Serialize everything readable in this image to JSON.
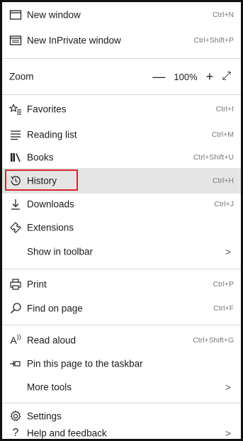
{
  "menu": {
    "new_window": {
      "label": "New window",
      "shortcut": "Ctrl+N",
      "icon": "new-window-icon"
    },
    "new_inprivate": {
      "label": "New InPrivate window",
      "shortcut": "Ctrl+Shift+P",
      "icon": "inprivate-icon"
    },
    "zoom": {
      "label": "Zoom",
      "minus": "—",
      "value": "100%",
      "plus": "+",
      "fullscreen": "⤢"
    },
    "favorites": {
      "label": "Favorites",
      "shortcut": "Ctrl+I",
      "icon": "favorites-icon"
    },
    "reading_list": {
      "label": "Reading list",
      "shortcut": "Ctrl+M",
      "icon": "reading-list-icon"
    },
    "books": {
      "label": "Books",
      "shortcut": "Ctrl+Shift+U",
      "icon": "books-icon"
    },
    "history": {
      "label": "History",
      "shortcut": "Ctrl+H",
      "icon": "history-icon"
    },
    "downloads": {
      "label": "Downloads",
      "shortcut": "Ctrl+J",
      "icon": "downloads-icon"
    },
    "extensions": {
      "label": "Extensions",
      "icon": "extensions-icon"
    },
    "show_in_toolbar": {
      "label": "Show in toolbar",
      "chevron": ">"
    },
    "print": {
      "label": "Print",
      "shortcut": "Ctrl+P",
      "icon": "print-icon"
    },
    "find_on_page": {
      "label": "Find on page",
      "shortcut": "Ctrl+F",
      "icon": "search-icon"
    },
    "read_aloud": {
      "label": "Read aloud",
      "shortcut": "Ctrl+Shift+G",
      "icon": "read-aloud-icon"
    },
    "pin_taskbar": {
      "label": "Pin this page to the taskbar",
      "icon": "pin-icon"
    },
    "more_tools": {
      "label": "More tools",
      "chevron": ">"
    },
    "settings": {
      "label": "Settings",
      "icon": "gear-icon"
    },
    "help": {
      "label": "Help and feedback",
      "chevron": ">",
      "icon": "help-icon"
    }
  },
  "colors": {
    "highlight_bg": "#e5e5e5",
    "highlight_border": "#d9232e"
  }
}
